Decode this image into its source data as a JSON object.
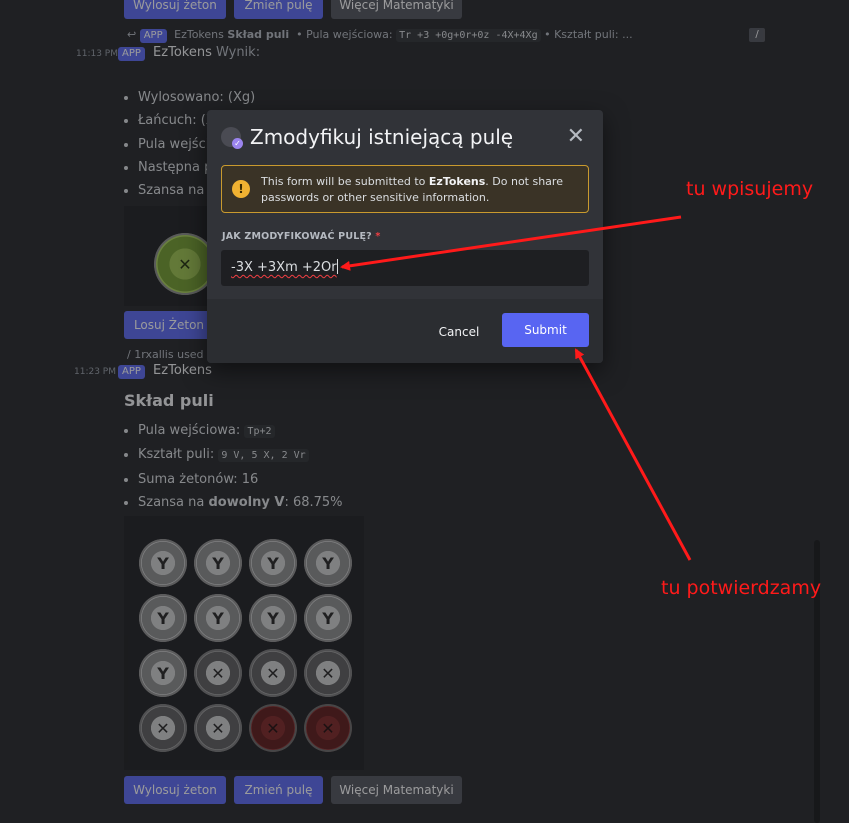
{
  "top_buttons": [
    "Wylosuj żeton",
    "Zmień pulę",
    "Więcej Matematyki"
  ],
  "msg1": {
    "reply_tag": "APP",
    "reply_author": "EzTokens",
    "reply_command": "Skład puli",
    "reply_info_1": "• Pula wejściowa:",
    "reply_code_1": "Tr +3 +0g+0r+0z -4X+4Xg",
    "reply_info_2": "• Kształt puli: ...",
    "time": "11:13 PM",
    "tag": "APP",
    "author": "EzTokens",
    "text": "Wynik:",
    "bullets": [
      "Wylosowano: (Xg)",
      "Łańcuch: (X",
      "Pula wejści",
      "Następna p",
      "Szansa na r"
    ]
  },
  "msg1_button": "Losuj Żeton",
  "msg2": {
    "reply_text": "1rxallis used",
    "time": "11:23 PM",
    "tag": "APP",
    "author": "EzTokens",
    "heading": "Skład puli",
    "b1_label": "Pula wejściowa:",
    "b1_code": "Tp+2",
    "b2_label": "Kształt puli:",
    "b2_code": "9 V, 5 X, 2 Vr",
    "b3": "Suma żetonów: 16",
    "b4_prefix": "Szansa na",
    "b4_bold": "dowolny V",
    "b4_suffix": ": 68.75%"
  },
  "tokens": {
    "grid": [
      [
        "v",
        "v",
        "v",
        "v"
      ],
      [
        "v",
        "v",
        "v",
        "v"
      ],
      [
        "v",
        "x",
        "x",
        "x"
      ],
      [
        "x",
        "x",
        "r",
        "r"
      ]
    ],
    "glyph_v": "Y",
    "glyph_x": "✕"
  },
  "bottom_buttons": [
    "Wylosuj żeton",
    "Zmień pulę",
    "Więcej Matematyki"
  ],
  "modal": {
    "title": "Zmodyfikuj istniejącą pulę",
    "warning_pre": "This form will be submitted to ",
    "warning_bold": "EzTokens",
    "warning_post": ". Do not share passwords or other sensitive information.",
    "field_label": "JAK ZMODYFIKOWAĆ PULĘ?",
    "required_mark": "*",
    "input_value": "-3X +3Xm +2Or",
    "cancel": "Cancel",
    "submit": "Submit"
  },
  "annotations": {
    "input_note": "tu wpisujemy",
    "submit_note": "tu potwierdzamy",
    "color": "#ff1a1a"
  },
  "colors": {
    "accent": "#5865f2",
    "warning": "#f0b232",
    "danger": "#f23f43"
  }
}
